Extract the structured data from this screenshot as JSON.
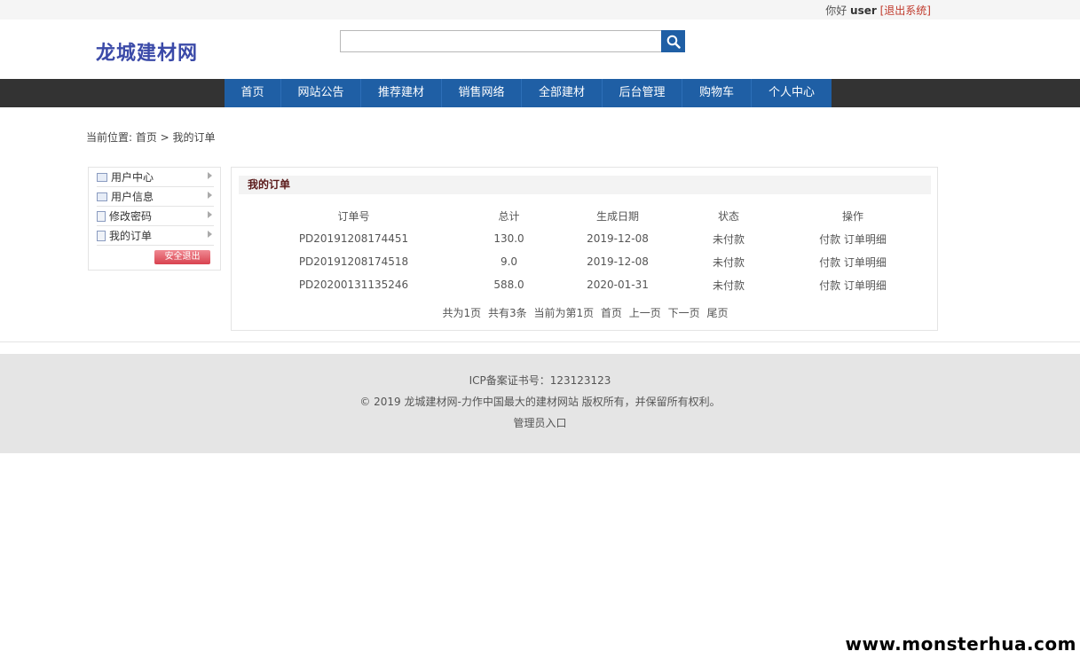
{
  "topbar": {
    "greeting": "你好 ",
    "username": "user",
    "logout": "[退出系统]"
  },
  "header": {
    "logo": "龙城建材网",
    "search_placeholder": "",
    "search_icon": "search-icon"
  },
  "nav": {
    "items": [
      {
        "label": "首页"
      },
      {
        "label": "网站公告"
      },
      {
        "label": "推荐建材"
      },
      {
        "label": "销售网络"
      },
      {
        "label": "全部建材"
      },
      {
        "label": "后台管理"
      },
      {
        "label": "购物车"
      },
      {
        "label": "个人中心"
      }
    ]
  },
  "breadcrumb": {
    "text": "当前位置: 首页 > 我的订单"
  },
  "sidebar": {
    "items": [
      {
        "label": "用户中心"
      },
      {
        "label": "用户信息"
      },
      {
        "label": "修改密码"
      },
      {
        "label": "我的订单"
      }
    ],
    "logout_button": "安全退出"
  },
  "panel": {
    "title": "我的订单",
    "headers": [
      "订单号",
      "总计",
      "生成日期",
      "状态",
      "操作"
    ],
    "rows": [
      {
        "id": "PD20191208174451",
        "total": "130.0",
        "date": "2019-12-08",
        "status": "未付款",
        "pay": "付款",
        "detail": "订单明细"
      },
      {
        "id": "PD20191208174518",
        "total": "9.0",
        "date": "2019-12-08",
        "status": "未付款",
        "pay": "付款",
        "detail": "订单明细"
      },
      {
        "id": "PD20200131135246",
        "total": "588.0",
        "date": "2020-01-31",
        "status": "未付款",
        "pay": "付款",
        "detail": "订单明细"
      }
    ],
    "pager": {
      "total_pages": "共为1页",
      "total_items": "共有3条",
      "current": "当前为第1页",
      "first": "首页",
      "prev": "上一页",
      "next": "下一页",
      "last": "尾页"
    }
  },
  "footer": {
    "icp": "ICP备案证书号：123123123",
    "copyright": "© 2019 龙城建材网-力作中国最大的建材网站 版权所有，并保留所有权利。",
    "admin": "管理员入口"
  },
  "watermark": "www.monsterhua.com",
  "colors": {
    "nav_blue": "#1f5fa5",
    "nav_bar": "#333333",
    "logo": "#3b4aa8",
    "logout": "#c0392b"
  }
}
